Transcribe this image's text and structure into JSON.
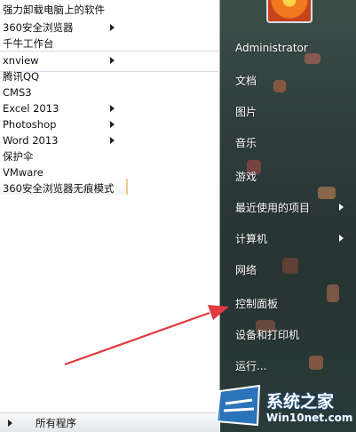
{
  "left_programs": [
    {
      "label": "强力卸载电脑上的软件",
      "has_submenu": false
    },
    {
      "label": "360安全浏览器",
      "has_submenu": true
    },
    {
      "label": "千牛工作台",
      "has_submenu": false
    },
    {
      "label": "xnview",
      "has_submenu": true
    },
    {
      "label": "腾讯QQ",
      "has_submenu": false
    },
    {
      "label": "CMS3",
      "has_submenu": false
    },
    {
      "label": "Excel 2013",
      "has_submenu": true
    },
    {
      "label": "Photoshop",
      "has_submenu": true
    },
    {
      "label": "Word 2013",
      "has_submenu": true
    },
    {
      "label": "保护伞",
      "has_submenu": false
    },
    {
      "label": "VMware",
      "has_submenu": false
    },
    {
      "label": "360安全浏览器无痕模式",
      "has_submenu": false
    }
  ],
  "all_programs": {
    "label": "所有程序"
  },
  "right_items": [
    {
      "label": "Administrator",
      "has_submenu": false
    },
    {
      "label": "文档",
      "has_submenu": false
    },
    {
      "label": "图片",
      "has_submenu": false
    },
    {
      "label": "音乐",
      "has_submenu": false
    },
    {
      "label": "游戏",
      "has_submenu": false
    },
    {
      "label": "最近使用的项目",
      "has_submenu": true
    },
    {
      "label": "计算机",
      "has_submenu": true
    },
    {
      "label": "网络",
      "has_submenu": false
    },
    {
      "label": "控制面板",
      "has_submenu": false
    },
    {
      "label": "设备和打印机",
      "has_submenu": false
    },
    {
      "label": "运行...",
      "has_submenu": false
    }
  ],
  "watermark": {
    "main": "系统之家",
    "url": "Win10net.com"
  },
  "colors": {
    "annotation_arrow": "#e0393f",
    "right_pane": "#2e3d3c",
    "highlight_border": "#f1c98a"
  },
  "icons": {
    "avatar": "flower-avatar-icon",
    "logo": "windows-logo-icon"
  }
}
